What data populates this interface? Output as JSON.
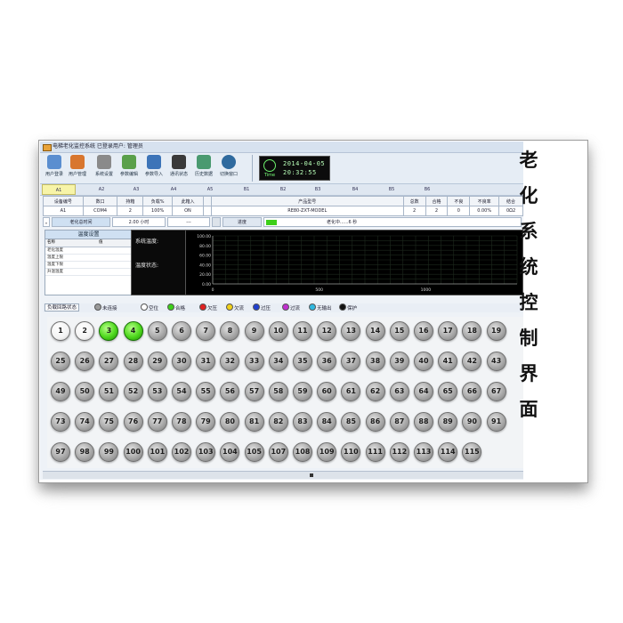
{
  "window": {
    "title": "电梯老化监控系统 已登录用户: 管理员"
  },
  "toolbar": {
    "buttons": [
      {
        "label": "用户登录",
        "icon": "users-icon",
        "color": "#5a8ed0"
      },
      {
        "label": "用户管理",
        "icon": "user-settings-icon",
        "color": "#d8762e"
      },
      {
        "label": "系统设置",
        "icon": "tools-icon",
        "color": "#8a8a8a"
      },
      {
        "label": "参数编辑",
        "icon": "monitor-edit-icon",
        "color": "#5aa04a"
      },
      {
        "label": "参数导入",
        "icon": "import-icon",
        "color": "#3d74b8"
      },
      {
        "label": "通讯状态",
        "icon": "comm-icon",
        "color": "#3a3a3a"
      },
      {
        "label": "历史数据",
        "icon": "history-icon",
        "color": "#4a9a70"
      },
      {
        "label": "切换窗口",
        "icon": "globe-icon",
        "color": "#2f6a9e"
      }
    ],
    "clock": {
      "icon_label": "Time",
      "date": "2014-04-05",
      "time": "20:32:55"
    }
  },
  "channels": [
    "A1",
    "A2",
    "A3",
    "A4",
    "A5",
    "B1",
    "B2",
    "B3",
    "B4",
    "B5",
    "B6"
  ],
  "selected_channel": "A1",
  "info_table": {
    "headers": [
      "设备编号",
      "数口",
      "持箱",
      "负载%",
      "此箱入",
      "",
      "产品型号",
      "总数",
      "合格",
      "不良",
      "不良率",
      "结合"
    ],
    "values": [
      "A1",
      "COM4",
      "2",
      "100%",
      "ON",
      "",
      "RE80-ZXT-MODEL",
      "2",
      "2",
      "0",
      "0.00%",
      "0Ω2"
    ]
  },
  "row3": {
    "label": "老化总时间",
    "value": "2.00 小时",
    "blank": "---",
    "progress_label": "进度",
    "status": "老化中......6 秒"
  },
  "temp_panel": {
    "title": "温度设置",
    "col_name": "名称",
    "col_value": "值",
    "rows": [
      "老化温度",
      "温度上限",
      "温度下限",
      "升温温度"
    ]
  },
  "status_panel": {
    "line1": "系统温度:",
    "line2": "温度状态:"
  },
  "chart_data": {
    "type": "line",
    "title": "",
    "xlabel": "",
    "ylabel": "",
    "y_ticks": [
      "100.00",
      "80.00",
      "60.00",
      "40.00",
      "20.00",
      "0.00"
    ],
    "x_ticks": [
      "0",
      "500",
      "1000"
    ],
    "series": []
  },
  "legend": {
    "label": "负载回路状态",
    "items": [
      {
        "label": "未连接",
        "color": "#9a9a9a"
      },
      {
        "label": "空位",
        "color": "#ffffff"
      },
      {
        "label": "合格",
        "color": "#3dcf1a"
      },
      {
        "label": "欠压",
        "color": "#e02020"
      },
      {
        "label": "欠流",
        "color": "#f0d01a"
      },
      {
        "label": "过压",
        "color": "#2040d0"
      },
      {
        "label": "过流",
        "color": "#c030d0"
      },
      {
        "label": "无输出",
        "color": "#30b8e0"
      },
      {
        "label": "保护",
        "color": "#111111"
      }
    ]
  },
  "slots": [
    [
      "1",
      "2",
      "3",
      "4",
      "5",
      "6",
      "7",
      "8",
      "9",
      "10",
      "11",
      "12",
      "13",
      "14",
      "15",
      "16",
      "17",
      "18",
      "19"
    ],
    [
      "25",
      "26",
      "27",
      "28",
      "29",
      "30",
      "31",
      "32",
      "33",
      "34",
      "35",
      "36",
      "37",
      "38",
      "39",
      "40",
      "41",
      "42",
      "43"
    ],
    [
      "49",
      "50",
      "51",
      "52",
      "53",
      "54",
      "55",
      "56",
      "57",
      "58",
      "59",
      "60",
      "61",
      "62",
      "63",
      "64",
      "65",
      "66",
      "67"
    ],
    [
      "73",
      "74",
      "75",
      "76",
      "77",
      "78",
      "79",
      "80",
      "81",
      "82",
      "83",
      "84",
      "85",
      "86",
      "87",
      "88",
      "89",
      "90",
      "91"
    ],
    [
      "97",
      "98",
      "99",
      "100",
      "101",
      "102",
      "103",
      "104",
      "105",
      "107",
      "108",
      "109",
      "110",
      "111",
      "112",
      "113",
      "114",
      "115"
    ]
  ],
  "slot_states": {
    "1": "white",
    "2": "white",
    "3": "green",
    "4": "green"
  },
  "side_label": [
    "老",
    "化",
    "系",
    "统",
    "控",
    "制",
    "界",
    "面"
  ]
}
